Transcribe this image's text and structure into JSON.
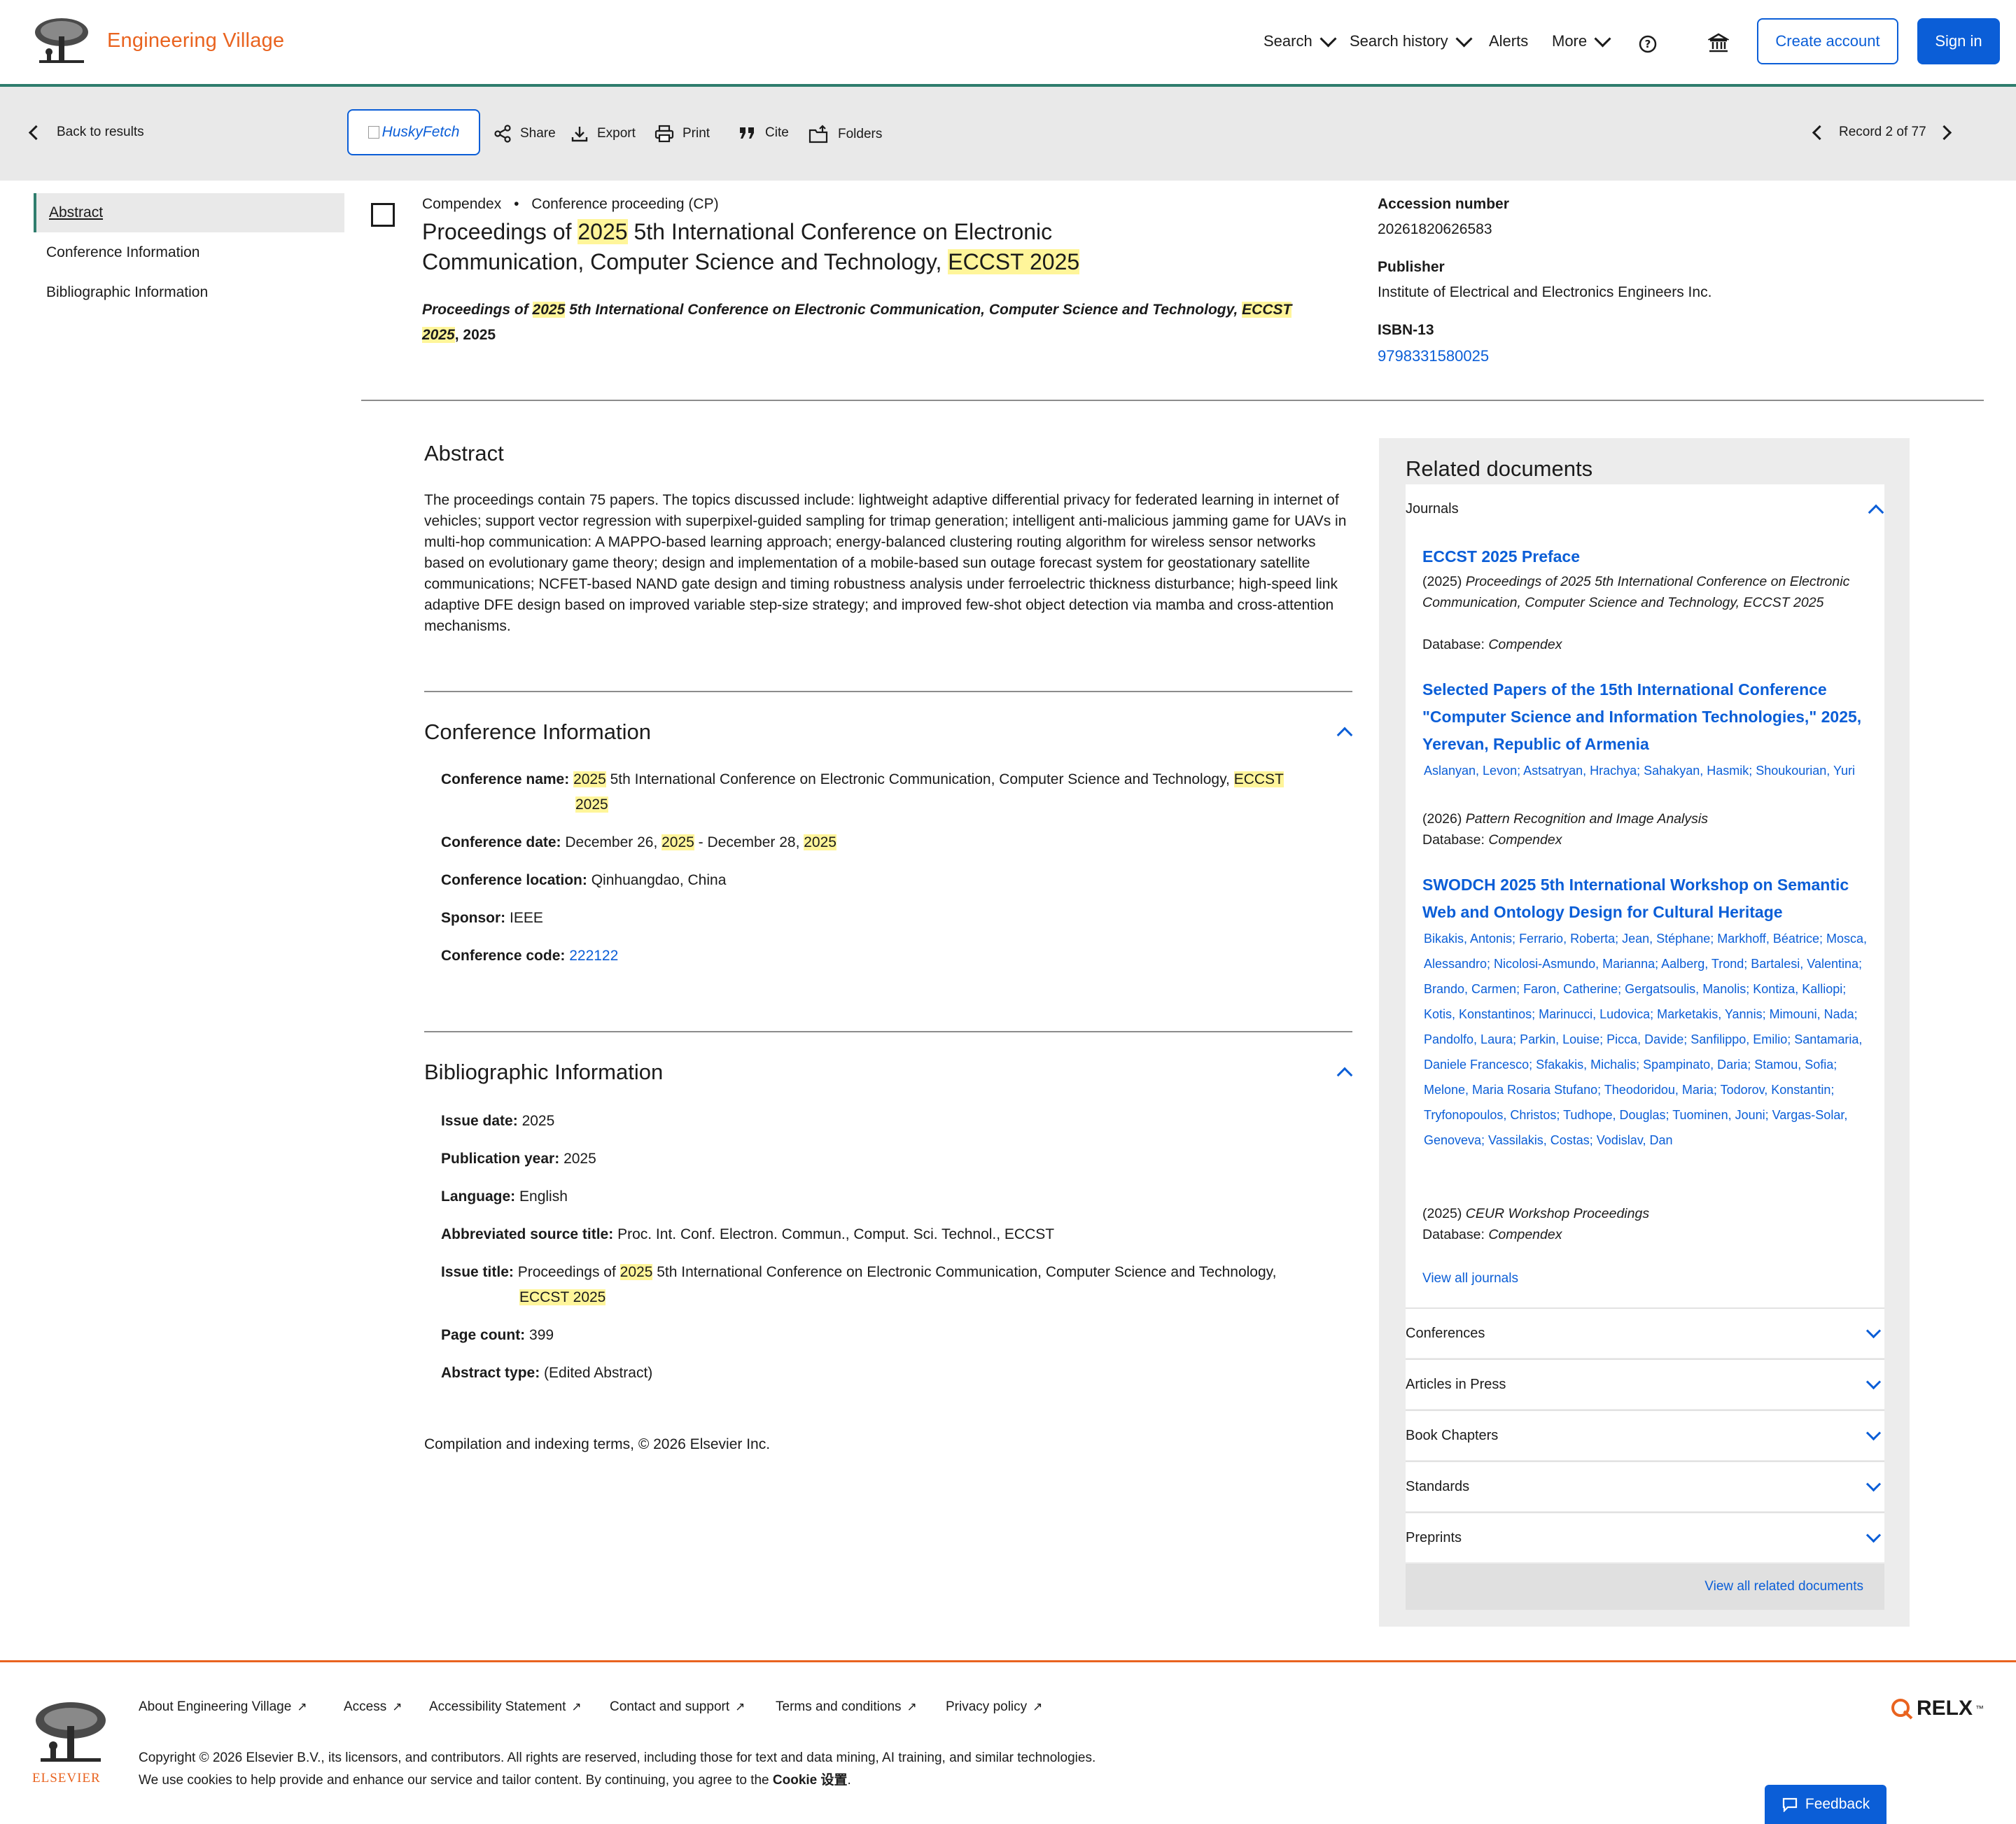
{
  "header": {
    "brand": "Engineering Village",
    "nav": {
      "search": "Search",
      "search_history": "Search history",
      "alerts": "Alerts",
      "more": "More"
    },
    "create_account": "Create account",
    "sign_in": "Sign in"
  },
  "toolbar": {
    "back": "Back to results",
    "husky": "HuskyFetch",
    "share": "Share",
    "export": "Export",
    "print": "Print",
    "cite": "Cite",
    "folders": "Folders",
    "record": "Record 2 of 77"
  },
  "left_nav": [
    "Abstract",
    "Conference Information",
    "Bibliographic Information"
  ],
  "record": {
    "database": "Compendex",
    "doc_type": "Conference proceeding (CP)",
    "title": {
      "pre": "Proceedings of ",
      "y1": "2025",
      "mid": " 5th International Conference on Electronic Communication, Computer Science and Technology, ",
      "acr": "ECCST",
      "sp": " ",
      "y2": "2025"
    },
    "source": {
      "pre": "Proceedings of ",
      "y1": "2025",
      "mid": " 5th International Conference on Electronic Communication, Computer Science and Technology, ",
      "acr": "ECCST",
      "sp": " ",
      "y2": "2025",
      "post": ", 2025"
    },
    "accession_label": "Accession number",
    "accession": "20261820626583",
    "publisher_label": "Publisher",
    "publisher": "Institute of Electrical and Electronics Engineers Inc.",
    "isbn_label": "ISBN-13",
    "isbn": "9798331580025"
  },
  "abstract": {
    "heading": "Abstract",
    "text": "The proceedings contain 75 papers. The topics discussed include: lightweight adaptive differential privacy for federated learning in internet of vehicles; support vector regression with superpixel-guided sampling for trimap generation; intelligent anti-malicious jamming game for UAVs in multi-hop communication: A MAPPO-based learning approach; energy-balanced clustering routing algorithm for wireless sensor networks based on evolutionary game theory; design and implementation of a mobile-based sun outage forecast system for geostationary satellite communications; NCFET-based NAND gate design and timing robustness analysis under ferroelectric thickness disturbance; high-speed link adaptive DFE design based on improved variable step-size strategy; and improved few-shot object detection via mamba and cross-attention mechanisms."
  },
  "conference": {
    "heading": "Conference Information",
    "name_label": "Conference name:",
    "name": {
      "y1": "2025",
      "mid": " 5th International Conference on Electronic Communication, Computer Science and Technology, ",
      "acr": "ECCST",
      "sp": " ",
      "y2": "2025"
    },
    "date_label": "Conference date:",
    "date": {
      "a": "December 26, ",
      "y1": "2025",
      "b": " - December 28, ",
      "y2": "2025"
    },
    "location_label": "Conference location:",
    "location": "Qinhuangdao, China",
    "sponsor_label": "Sponsor:",
    "sponsor": "IEEE",
    "code_label": "Conference code:",
    "code": "222122"
  },
  "bibliographic": {
    "heading": "Bibliographic Information",
    "issue_date_label": "Issue date:",
    "issue_date": "2025",
    "pub_year_label": "Publication year:",
    "pub_year": "2025",
    "language_label": "Language:",
    "language": "English",
    "abbr_label": "Abbreviated source title:",
    "abbr": "Proc. Int. Conf. Electron. Commun., Comput. Sci. Technol., ECCST",
    "issue_title_label": "Issue title:",
    "issue_title": {
      "pre": "Proceedings of ",
      "y1": "2025",
      "mid": " 5th International Conference on Electronic Communication, Computer Science and Technology, ",
      "acr": "ECCST",
      "sp": " ",
      "y2": "2025"
    },
    "page_count_label": "Page count:",
    "page_count": "399",
    "abstract_type_label": "Abstract type:",
    "abstract_type": "(Edited Abstract)"
  },
  "compilation": "Compilation and indexing terms, © 2026 Elsevier Inc.",
  "related": {
    "heading": "Related documents",
    "journals_label": "Journals",
    "items": [
      {
        "title": "ECCST 2025 Preface",
        "year": "(2025) ",
        "source": "Proceedings of 2025 5th International Conference on Electronic Communication, Computer Science and Technology, ECCST 2025",
        "db_label": "Database: ",
        "db": "Compendex"
      },
      {
        "title": "Selected Papers of the 15th International Conference \"Computer Science and Information Technologies,\" 2025, Yerevan, Republic of Armenia",
        "authors": "Aslanyan, Levon; Astsatryan, Hrachya; Sahakyan, Hasmik; Shoukourian, Yuri",
        "year": "(2026) ",
        "source": "Pattern Recognition and Image Analysis",
        "db_label": "Database: ",
        "db": "Compendex"
      },
      {
        "title": "SWODCH 2025 5th International Workshop on Semantic Web and Ontology Design for Cultural Heritage",
        "authors": "Bikakis, Antonis; Ferrario, Roberta; Jean, Stéphane; Markhoff, Béatrice; Mosca, Alessandro; Nicolosi-Asmundo, Marianna; Aalberg, Trond; Bartalesi, Valentina; Brando, Carmen; Faron, Catherine; Gergatsoulis, Manolis; Kontiza, Kalliopi; Kotis, Konstantinos; Marinucci, Ludovica; Marketakis, Yannis; Mimouni, Nada; Pandolfo, Laura; Parkin, Louise; Picca, Davide; Sanfilippo, Emilio; Santamaria, Daniele Francesco; Sfakakis, Michalis; Spampinato, Daria; Stamou, Sofia; Melone, Maria Rosaria Stufano; Theodoridou, Maria; Todorov, Konstantin; Tryfonopoulos, Christos; Tudhope, Douglas; Tuominen, Jouni; Vargas-Solar, Genoveva; Vassilakis, Costas; Vodislav, Dan",
        "year": "(2025) ",
        "source": "CEUR Workshop Proceedings",
        "db_label": "Database: ",
        "db": "Compendex"
      }
    ],
    "view_all_journals": "View all journals",
    "sections": [
      "Conferences",
      "Articles in Press",
      "Book Chapters",
      "Standards",
      "Preprints"
    ],
    "view_all": "View all related documents"
  },
  "footer": {
    "links": [
      "About Engineering Village",
      "Access",
      "Accessibility Statement",
      "Contact and support",
      "Terms and conditions",
      "Privacy policy"
    ],
    "copyright": "Copyright © 2026 Elsevier B.V., its licensors, and contributors. All rights are reserved, including those for text and data mining, AI training, and similar technologies.",
    "cookies_pre": "We use cookies to help provide and enhance our service and tailor content. By continuing, you agree to the ",
    "cookies_link": "Cookie 设置",
    "cookies_post": ".",
    "elsevier": "ELSEVIER",
    "relx": "RELX",
    "tm": "™",
    "feedback": "Feedback"
  },
  "colors": {
    "accent_blue": "#0b5ed7",
    "brand_orange": "#e9631f",
    "teal": "#2f7d6d",
    "highlight": "#fff59a"
  }
}
